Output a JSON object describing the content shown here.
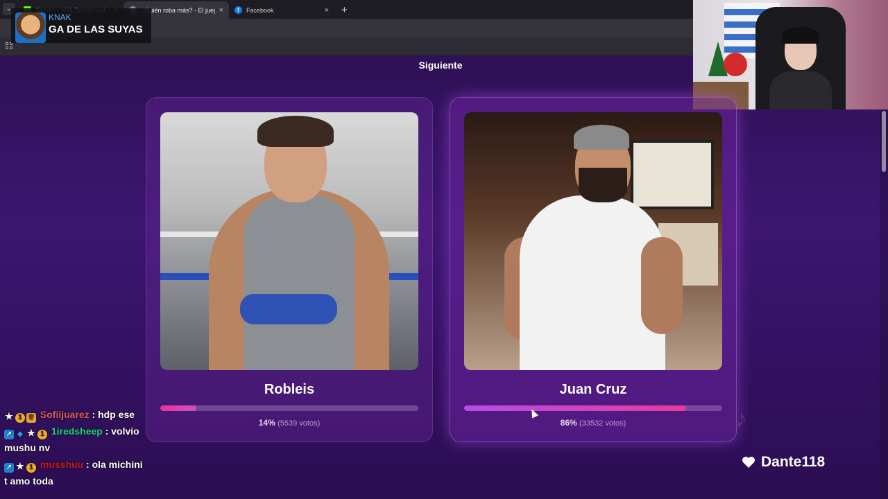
{
  "browser": {
    "tabs": [
      {
        "label": "Stream - Kick Dashboard",
        "favicon": "kick-icon",
        "active": false
      },
      {
        "label": "¿Quién roba más? - El juego que",
        "favicon": "page-icon",
        "active": true
      },
      {
        "label": "Facebook",
        "favicon": "facebook-icon",
        "active": false
      }
    ],
    "close_glyph": "×",
    "new_tab_glyph": "+"
  },
  "overlay": {
    "username": "KNAK",
    "message": "GA DE LAS SUYAS"
  },
  "game": {
    "next_label": "Siguiente",
    "candidates": [
      {
        "name": "Robleis",
        "percent_label": "14%",
        "percent": 14,
        "votes_label": "(5539 votos)"
      },
      {
        "name": "Juan Cruz",
        "percent_label": "86%",
        "percent": 86,
        "votes_label": "(33532 votos)"
      }
    ]
  },
  "chat": [
    {
      "user": "Sofiijuarez",
      "text": " : hdp ese",
      "cont": ""
    },
    {
      "user": "1iredsheep",
      "text": " : volvio",
      "cont": "mushu nv"
    },
    {
      "user": "musshuu",
      "text": " : ola michini",
      "cont": "t amo toda"
    }
  ],
  "donor": {
    "name": "Dante118",
    "icon": "heart-icon"
  },
  "colors": {
    "background": "#3d1670",
    "bar_pink": "#e8329b",
    "bar_purple": "#b44de6",
    "username_blue": "#5fa7ff"
  }
}
